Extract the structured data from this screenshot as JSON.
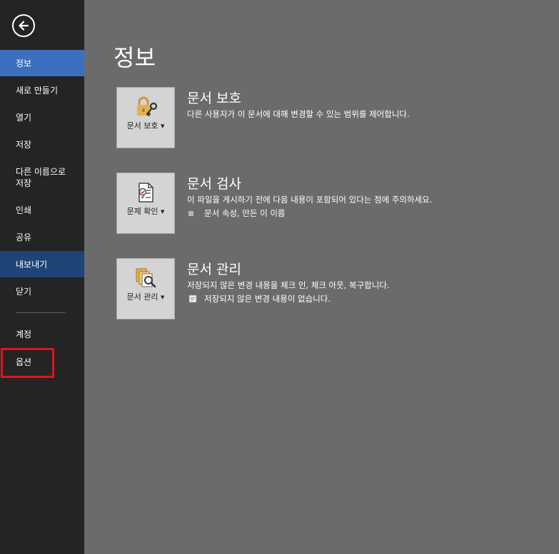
{
  "sidebar": {
    "items": [
      {
        "label": "정보"
      },
      {
        "label": "새로 만들기"
      },
      {
        "label": "열기"
      },
      {
        "label": "저장"
      },
      {
        "label": "다른 이름으로\n저장"
      },
      {
        "label": "인쇄"
      },
      {
        "label": "공유"
      },
      {
        "label": "내보내기"
      },
      {
        "label": "닫기"
      },
      {
        "label": "계정"
      },
      {
        "label": "옵션"
      }
    ]
  },
  "main": {
    "title": "정보",
    "sections": [
      {
        "button_label": "문서 보호",
        "title": "문서 보호",
        "description": "다른 사용자가 이 문서에 대해 변경할 수 있는 범위를 제어합니다."
      },
      {
        "button_label": "문제 확인",
        "title": "문서 검사",
        "description": "이 파일을 게시하기 전에 다음 내용이 포함되어 있다는 점에 주의하세요.",
        "bullet": "문서 속성, 만든 이 이름"
      },
      {
        "button_label": "문서 관리",
        "title": "문서 관리",
        "description": "저장되지 않은 변경 내용을 체크 인, 체크 아웃, 복구합니다.",
        "bullet": "저장되지 않은 변경 내용이 없습니다."
      }
    ]
  },
  "colors": {
    "sidebar_bg": "#242424",
    "main_bg": "#6b6b6b",
    "active_item": "#3c6fbe",
    "export_item": "#1e4478",
    "highlight": "#e0141e"
  },
  "icons": {
    "back": "back-arrow-icon",
    "protect": "lock-key-icon",
    "inspect": "checklist-icon",
    "manage": "document-search-icon"
  }
}
